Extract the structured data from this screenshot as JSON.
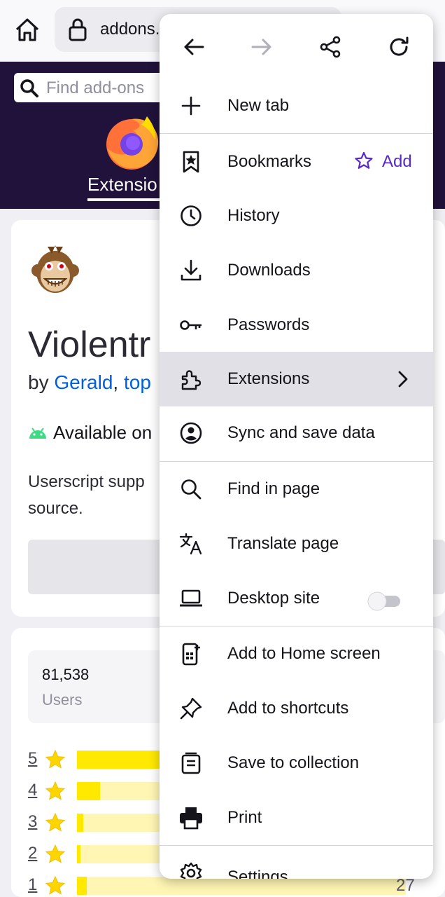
{
  "toolbar": {
    "url": "addons."
  },
  "page": {
    "search_placeholder": "Find add-ons",
    "nav_tab": "Extensio",
    "addon_title": "Violentr",
    "by": "by",
    "author1": "Gerald",
    "comma": ",",
    "author2": "top",
    "available": "Available on",
    "desc_line1": "Userscript supp",
    "desc_line2": "source.",
    "users_count": "81,538",
    "users_label": "Users",
    "ratings": [
      {
        "stars": "5",
        "fill": 0.95
      },
      {
        "stars": "4",
        "fill": 0.07
      },
      {
        "stars": "3",
        "fill": 0.02
      },
      {
        "stars": "2",
        "fill": 0.01
      },
      {
        "stars": "1",
        "fill": 0.03
      }
    ],
    "last_count": "27"
  },
  "menu": {
    "items": [
      {
        "id": "new-tab",
        "label": "New tab"
      },
      {
        "id": "bookmarks",
        "label": "Bookmarks",
        "action": "Add"
      },
      {
        "id": "history",
        "label": "History"
      },
      {
        "id": "downloads",
        "label": "Downloads"
      },
      {
        "id": "passwords",
        "label": "Passwords"
      },
      {
        "id": "extensions",
        "label": "Extensions"
      },
      {
        "id": "sync",
        "label": "Sync and save data"
      },
      {
        "id": "find",
        "label": "Find in page"
      },
      {
        "id": "translate",
        "label": "Translate page"
      },
      {
        "id": "desktop",
        "label": "Desktop site",
        "toggle": false
      },
      {
        "id": "home-screen",
        "label": "Add to Home screen"
      },
      {
        "id": "shortcuts",
        "label": "Add to shortcuts"
      },
      {
        "id": "collection",
        "label": "Save to collection"
      },
      {
        "id": "print",
        "label": "Print"
      },
      {
        "id": "settings",
        "label": "Settings"
      }
    ]
  },
  "colors": {
    "accent": "#592acb",
    "header_bg": "#20123a",
    "link": "#0060df",
    "highlight": "#e0e0e6"
  }
}
